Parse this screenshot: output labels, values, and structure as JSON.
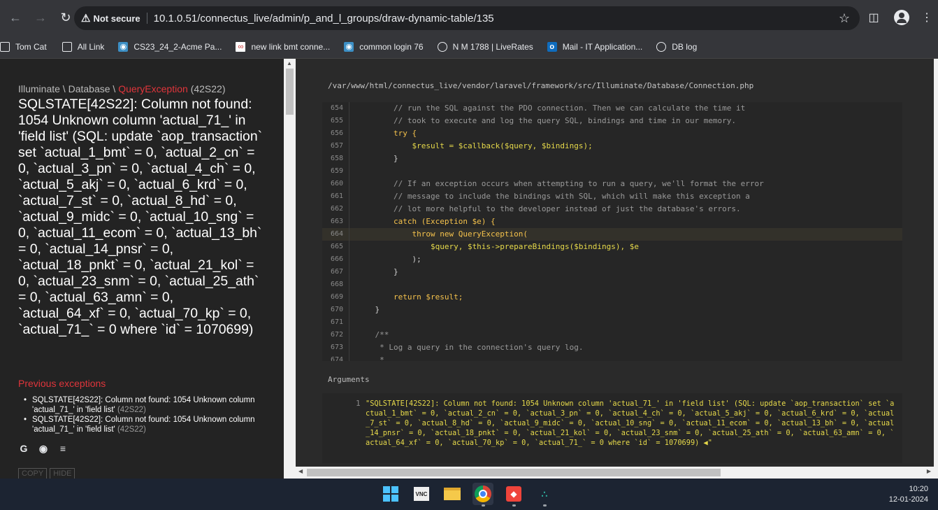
{
  "browser": {
    "security_label": "Not secure",
    "url": "10.1.0.51/connectus_live/admin/p_and_l_groups/draw-dynamic-table/135"
  },
  "bookmarks": [
    {
      "label": "Tom Cat",
      "icon": "folder-icon"
    },
    {
      "label": "All Link",
      "icon": "folder-icon"
    },
    {
      "label": "CS23_24_2-Acme Pa...",
      "icon": "acme-icon"
    },
    {
      "label": "new link bmt conne...",
      "icon": "link-icon"
    },
    {
      "label": "common login 76",
      "icon": "acme-icon"
    },
    {
      "label": "N M 1788 | LiveRates",
      "icon": "globe-icon"
    },
    {
      "label": "Mail - IT Application...",
      "icon": "outlook-icon"
    },
    {
      "label": "DB log",
      "icon": "globe-icon"
    }
  ],
  "error": {
    "namespace": "Illuminate \\ Database \\ ",
    "exception_class": "QueryException",
    "code": "(42S22)",
    "message": "SQLSTATE[42S22]: Column not found: 1054 Unknown column 'actual_71_' in 'field list' (SQL: update `aop_transaction` set `actual_1_bmt` = 0, `actual_2_cn` = 0, `actual_3_pn` = 0, `actual_4_ch` = 0, `actual_5_akj` = 0, `actual_6_krd` = 0, `actual_7_st` = 0, `actual_8_hd` = 0, `actual_9_midc` = 0, `actual_10_sng` = 0, `actual_11_ecom` = 0, `actual_13_bh` = 0, `actual_14_pnsr` = 0, `actual_18_pnkt` = 0, `actual_21_kol` = 0, `actual_23_snm` = 0, `actual_25_ath` = 0, `actual_63_amn` = 0, `actual_64_xf` = 0, `actual_70_kp` = 0, `actual_71_` = 0 where `id` = 1070699)",
    "previous_title": "Previous exceptions",
    "previous": [
      {
        "text": "SQLSTATE[42S22]: Column not found: 1054 Unknown column 'actual_71_' in 'field list'",
        "code": "(42S22)"
      },
      {
        "text": "SQLSTATE[42S22]: Column not found: 1054 Unknown column 'actual_71_' in 'field list'",
        "code": "(42S22)"
      }
    ],
    "buttons": {
      "copy": "COPY",
      "hide": "HIDE"
    }
  },
  "source": {
    "file_path": "/var/www/html/connectus_live/vendor/laravel/framework/src/Illuminate/Database/Connection.php",
    "highlighted_line": 664,
    "lines": [
      {
        "n": "654",
        "code": "        // run the SQL against the PDO connection. Then we can calculate the time it"
      },
      {
        "n": "655",
        "code": "        // took to execute and log the query SQL, bindings and time in our memory."
      },
      {
        "n": "656",
        "code": "        try {"
      },
      {
        "n": "657",
        "code": "            $result = $callback($query, $bindings);"
      },
      {
        "n": "658",
        "code": "        }"
      },
      {
        "n": "659",
        "code": ""
      },
      {
        "n": "660",
        "code": "        // If an exception occurs when attempting to run a query, we'll format the error"
      },
      {
        "n": "661",
        "code": "        // message to include the bindings with SQL, which will make this exception a"
      },
      {
        "n": "662",
        "code": "        // lot more helpful to the developer instead of just the database's errors."
      },
      {
        "n": "663",
        "code": "        catch (Exception $e) {"
      },
      {
        "n": "664",
        "code": "            throw new QueryException("
      },
      {
        "n": "665",
        "code": "                $query, $this->prepareBindings($bindings), $e"
      },
      {
        "n": "666",
        "code": "            );"
      },
      {
        "n": "667",
        "code": "        }"
      },
      {
        "n": "668",
        "code": ""
      },
      {
        "n": "669",
        "code": "        return $result;"
      },
      {
        "n": "670",
        "code": "    }"
      },
      {
        "n": "671",
        "code": ""
      },
      {
        "n": "672",
        "code": "    /**"
      },
      {
        "n": "673",
        "code": "     * Log a query in the connection's query log."
      },
      {
        "n": "674",
        "code": "     *"
      }
    ],
    "arguments_title": "Arguments",
    "argument_index": "1",
    "argument_text": "\"SQLSTATE[42S22]: Column not found: 1054 Unknown column 'actual_71_' in 'field list' (SQL: update `aop_transaction` set `actual_1_bmt` = 0, `actual_2_cn` = 0, `actual_3_pn` = 0, `actual_4_ch` = 0, `actual_5_akj` = 0, `actual_6_krd` = 0, `actual_7_st` = 0, `actual_8_hd` = 0, `actual_9_midc` = 0, `actual_10_sng` = 0, `actual_11_ecom` = 0, `actual_13_bh` = 0, `actual_14_pnsr` = 0, `actual_18_pnkt` = 0, `actual_21_kol` = 0, `actual_23_snm` = 0, `actual_25_ath` = 0, `actual_63_amn` = 0, `actual_64_xf` = 0, `actual_70_kp` = 0, `actual_71_` = 0 where `id` = 1070699) ◀\""
  },
  "taskbar": {
    "time": "10:20",
    "date": "12-01-2024",
    "apps": [
      "windows-start-icon",
      "vnc-viewer-icon",
      "file-explorer-icon",
      "chrome-icon",
      "anydesk-icon",
      "tally-icon"
    ]
  }
}
